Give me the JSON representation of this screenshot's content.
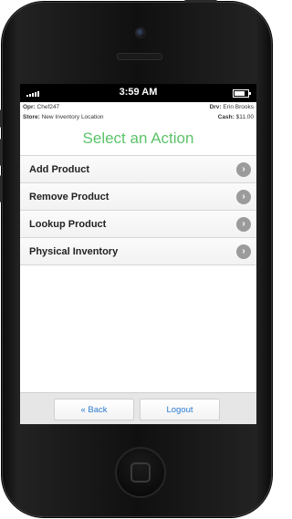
{
  "status": {
    "time": "3:59 AM"
  },
  "info": {
    "opr_label": "Opr:",
    "opr_value": "Chef247",
    "drv_label": "Drv:",
    "drv_value": "Erin Brooks",
    "store_label": "Store:",
    "store_value": "New Inventory Location",
    "cash_label": "Cash:",
    "cash_value": "$11.00"
  },
  "title": "Select an Action",
  "menu": [
    {
      "label": "Add Product"
    },
    {
      "label": "Remove Product"
    },
    {
      "label": "Lookup Product"
    },
    {
      "label": "Physical Inventory"
    }
  ],
  "footer": {
    "back": "« Back",
    "logout": "Logout"
  },
  "colors": {
    "title_green": "#5cc36a",
    "link_blue": "#2b7bd1"
  }
}
